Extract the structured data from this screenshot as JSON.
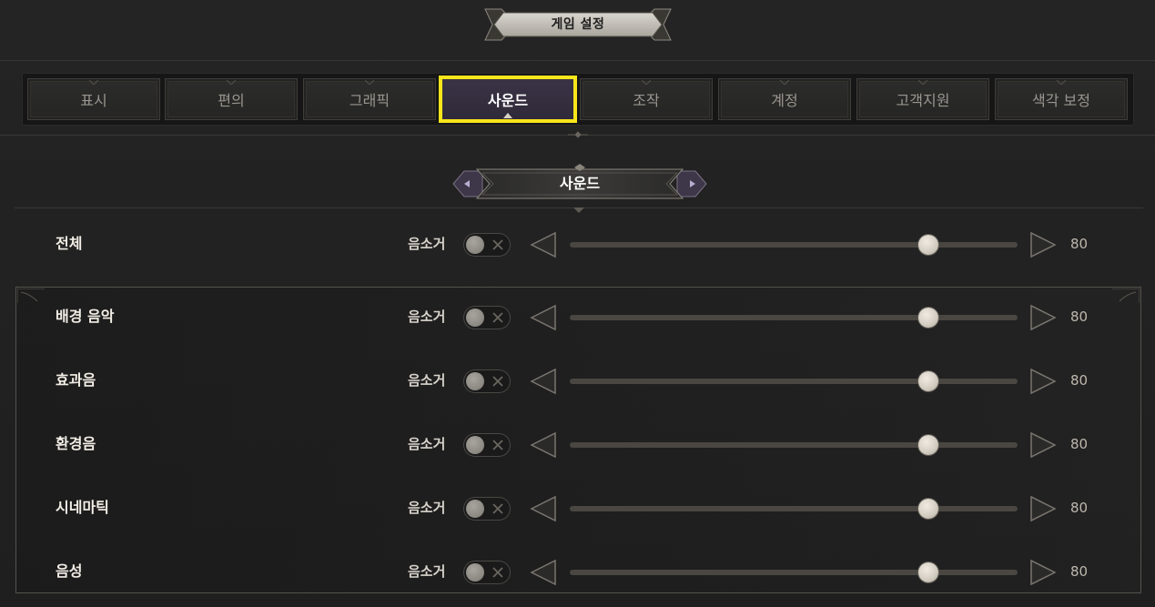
{
  "header": {
    "title": "게임 설정"
  },
  "tabs": [
    {
      "label": "표시",
      "active": false
    },
    {
      "label": "편의",
      "active": false
    },
    {
      "label": "그래픽",
      "active": false
    },
    {
      "label": "사운드",
      "active": true
    },
    {
      "label": "조작",
      "active": false
    },
    {
      "label": "계정",
      "active": false
    },
    {
      "label": "고객지원",
      "active": false
    },
    {
      "label": "색각 보정",
      "active": false
    }
  ],
  "section": {
    "title": "사운드"
  },
  "master": {
    "label": "전체",
    "mute_label": "음소거",
    "muted": false,
    "value": "80",
    "level_percent": 80
  },
  "channels": [
    {
      "label": "배경 음악",
      "mute_label": "음소거",
      "muted": false,
      "value": "80",
      "level_percent": 80
    },
    {
      "label": "효과음",
      "mute_label": "음소거",
      "muted": false,
      "value": "80",
      "level_percent": 80
    },
    {
      "label": "환경음",
      "mute_label": "음소거",
      "muted": false,
      "value": "80",
      "level_percent": 80
    },
    {
      "label": "시네마틱",
      "mute_label": "음소거",
      "muted": false,
      "value": "80",
      "level_percent": 80
    },
    {
      "label": "음성",
      "mute_label": "음소거",
      "muted": false,
      "value": "80",
      "level_percent": 80
    }
  ],
  "colors": {
    "highlight": "#f8e51a",
    "active_tab": "#3a3346",
    "background": "#232323",
    "track": "#4a4742",
    "thumb": "#e6e0d6"
  },
  "icons": {
    "mute_toggle_icon": "x-icon",
    "decrease": "left-triangle-icon",
    "increase": "right-triangle-icon"
  }
}
